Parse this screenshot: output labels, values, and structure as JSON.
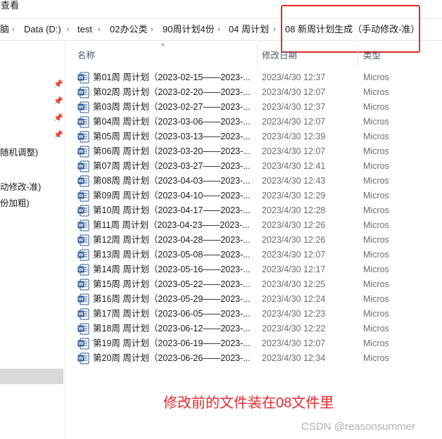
{
  "menubar": {
    "view_label": "查看"
  },
  "breadcrumb": {
    "items": [
      "脑",
      "Data (D:)",
      "test",
      "02办公类",
      "90周计划4份",
      "04 周计划",
      "08 新周计划生成（手动修改-准）"
    ]
  },
  "nav": {
    "items": [
      "随机调整)",
      "动修改-准)",
      "份加粗)"
    ]
  },
  "columns": {
    "name": "名称",
    "date": "修改日期",
    "type": "类型"
  },
  "files": [
    {
      "name": "第01周 周计划（2023-02-15——2023-...",
      "date": "2023/4/30 12:37",
      "type": "Micros"
    },
    {
      "name": "第02周 周计划（2023-02-20——2023-...",
      "date": "2023/4/30 12:07",
      "type": "Micros"
    },
    {
      "name": "第03周 周计划（2023-02-27——2023-...",
      "date": "2023/4/30 12:37",
      "type": "Micros"
    },
    {
      "name": "第04周 周计划（2023-03-06——2023-...",
      "date": "2023/4/30 12:07",
      "type": "Micros"
    },
    {
      "name": "第05周 周计划（2023-03-13——2023-...",
      "date": "2023/4/30 12:39",
      "type": "Micros"
    },
    {
      "name": "第06周 周计划（2023-03-20——2023-...",
      "date": "2023/4/30 12:07",
      "type": "Micros"
    },
    {
      "name": "第07周 周计划（2023-03-27——2023-...",
      "date": "2023/4/30 12:41",
      "type": "Micros"
    },
    {
      "name": "第08周 周计划（2023-04-03——2023-...",
      "date": "2023/4/30 12:43",
      "type": "Micros"
    },
    {
      "name": "第09周 周计划（2023-04-10——2023-...",
      "date": "2023/4/30 12:29",
      "type": "Micros"
    },
    {
      "name": "第10周 周计划（2023-04-17——2023-...",
      "date": "2023/4/30 12:28",
      "type": "Micros"
    },
    {
      "name": "第11周 周计划（2023-04-23——2023-...",
      "date": "2023/4/30 12:26",
      "type": "Micros"
    },
    {
      "name": "第12周 周计划（2023-04-28——2023-...",
      "date": "2023/4/30 12:26",
      "type": "Micros"
    },
    {
      "name": "第13周 周计划（2023-05-08——2023-...",
      "date": "2023/4/30 12:07",
      "type": "Micros"
    },
    {
      "name": "第14周 周计划（2023-05-16——2023-...",
      "date": "2023/4/30 12:17",
      "type": "Micros"
    },
    {
      "name": "第15周 周计划（2023-05-22——2023-...",
      "date": "2023/4/30 12:25",
      "type": "Micros"
    },
    {
      "name": "第16周 周计划（2023-05-29——2023-...",
      "date": "2023/4/30 12:24",
      "type": "Micros"
    },
    {
      "name": "第17周 周计划（2023-06-05——2023-...",
      "date": "2023/4/30 12:23",
      "type": "Micros"
    },
    {
      "name": "第18周 周计划（2023-06-12——2023-...",
      "date": "2023/4/30 12:22",
      "type": "Micros"
    },
    {
      "name": "第19周 周计划（2023-06-19——2023-...",
      "date": "2023/4/30 12:07",
      "type": "Micros"
    },
    {
      "name": "第20周 周计划（2023-06-26——2023-...",
      "date": "2023/4/30 12:34",
      "type": "Micros"
    }
  ],
  "annotation": {
    "text": "修改前的文件装在08文件里"
  },
  "watermark": {
    "text": "CSDN @reasonsummer"
  },
  "colors": {
    "annotation_red": "#e8282a",
    "word_blue": "#2b5797",
    "selection_gray": "#d9d9d9"
  }
}
